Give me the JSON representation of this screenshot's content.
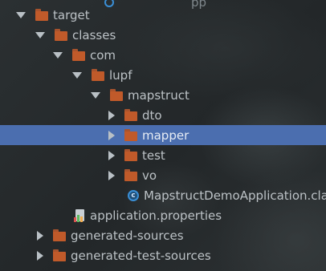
{
  "tree": {
    "rows": [
      {
        "label": "target",
        "icon": "folder-icon",
        "expanded": true
      },
      {
        "label": "classes",
        "icon": "folder-icon",
        "expanded": true
      },
      {
        "label": "com",
        "icon": "folder-icon",
        "expanded": true
      },
      {
        "label": "lupf",
        "icon": "folder-icon",
        "expanded": true
      },
      {
        "label": "mapstruct",
        "icon": "folder-icon",
        "expanded": true
      },
      {
        "label": "dto",
        "icon": "folder-icon",
        "expanded": false
      },
      {
        "label": "mapper",
        "icon": "folder-icon",
        "expanded": false,
        "selected": true
      },
      {
        "label": "test",
        "icon": "folder-icon",
        "expanded": false
      },
      {
        "label": "vo",
        "icon": "folder-icon",
        "expanded": false
      },
      {
        "label": "MapstructDemoApplication.cla",
        "icon": "class-file-icon"
      },
      {
        "label": "application.properties",
        "icon": "properties-file-icon"
      },
      {
        "label": "generated-sources",
        "icon": "folder-icon",
        "expanded": false
      },
      {
        "label": "generated-test-sources",
        "icon": "folder-icon",
        "expanded": false
      }
    ],
    "selection_color": "#4b6eaf",
    "folder_color": "#c05a2a"
  }
}
